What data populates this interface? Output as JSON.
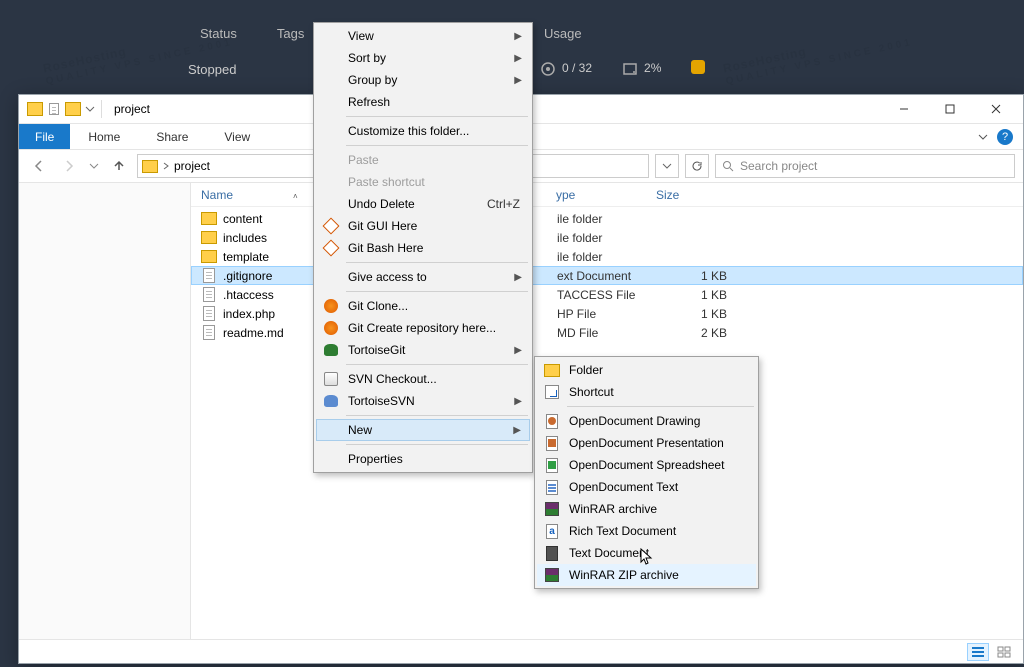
{
  "topbar": {
    "tabs": [
      "Status",
      "Tags"
    ],
    "status": "Stopped",
    "usage_label": "Usage",
    "cpu": "0 / 32",
    "mem": "2%"
  },
  "window": {
    "title": "project",
    "ribbon": {
      "file": "File",
      "tabs": [
        "Home",
        "Share",
        "View"
      ]
    },
    "breadcrumb": "project",
    "search_placeholder": "Search project"
  },
  "columns": {
    "name": "Name",
    "type": "ype",
    "size": "Size"
  },
  "files": [
    {
      "name": "content",
      "kind": "folder",
      "type": "ile folder",
      "size": ""
    },
    {
      "name": "includes",
      "kind": "folder",
      "type": "ile folder",
      "size": ""
    },
    {
      "name": "template",
      "kind": "folder",
      "type": "ile folder",
      "size": ""
    },
    {
      "name": ".gitignore",
      "kind": "file",
      "type": "ext Document",
      "size": "1 KB",
      "selected": true
    },
    {
      "name": ".htaccess",
      "kind": "file",
      "type": "TACCESS File",
      "size": "1 KB"
    },
    {
      "name": "index.php",
      "kind": "file",
      "type": "HP File",
      "size": "1 KB"
    },
    {
      "name": "readme.md",
      "kind": "file",
      "type": "MD File",
      "size": "2 KB"
    }
  ],
  "ctx": {
    "view": "View",
    "sortby": "Sort by",
    "groupby": "Group by",
    "refresh": "Refresh",
    "customize": "Customize this folder...",
    "paste": "Paste",
    "paste_shortcut": "Paste shortcut",
    "undo_delete": "Undo Delete",
    "undo_shortcut": "Ctrl+Z",
    "git_gui": "Git GUI Here",
    "git_bash": "Git Bash Here",
    "give_access": "Give access to",
    "git_clone": "Git Clone...",
    "git_create": "Git Create repository here...",
    "tortoisegit": "TortoiseGit",
    "svn_checkout": "SVN Checkout...",
    "tortoisesvn": "TortoiseSVN",
    "new": "New",
    "properties": "Properties"
  },
  "submenu": {
    "folder": "Folder",
    "shortcut": "Shortcut",
    "od_draw": "OpenDocument Drawing",
    "od_pres": "OpenDocument Presentation",
    "od_sheet": "OpenDocument Spreadsheet",
    "od_text": "OpenDocument Text",
    "winrar": "WinRAR archive",
    "rtf": "Rich Text Document",
    "txt": "Text Document",
    "zip": "WinRAR ZIP archive"
  },
  "watermark": "RoseHosting",
  "watermark_sub": "QUALITY VPS SINCE 2001"
}
